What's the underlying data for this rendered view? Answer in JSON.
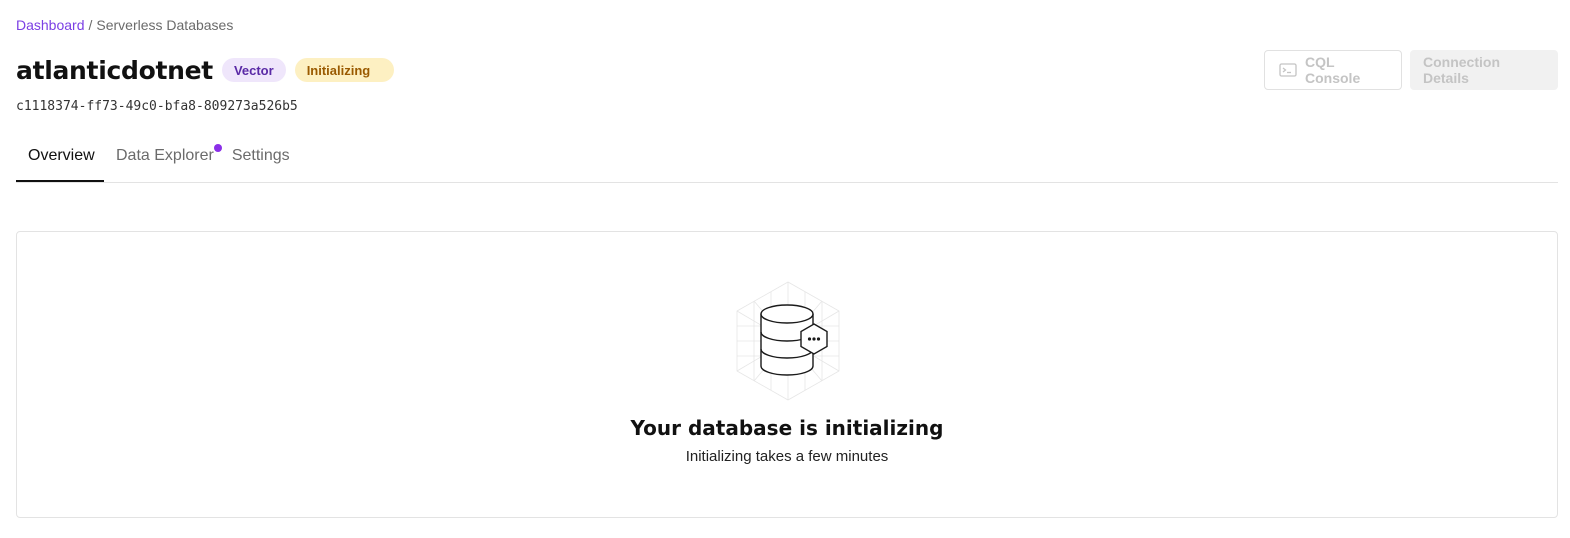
{
  "breadcrumb": {
    "root": "Dashboard",
    "separator": "/",
    "current": "Serverless Databases"
  },
  "database": {
    "name": "atlanticdotnet",
    "type_badge": "Vector",
    "status_badge": "Initializing",
    "id": "c1118374-ff73-49c0-bfa8-809273a526b5"
  },
  "actions": {
    "cql_console": "CQL Console",
    "connection_details": "Connection Details"
  },
  "tabs": [
    {
      "label": "Overview",
      "active": true
    },
    {
      "label": "Data Explorer",
      "active": false,
      "notification": true
    },
    {
      "label": "Settings",
      "active": false
    }
  ],
  "empty_state": {
    "icon": "database-initializing-icon",
    "title": "Your database is initializing",
    "subtitle": "Initializing takes a few minutes"
  },
  "colors": {
    "accent": "#7b3fe4",
    "vector_badge_bg": "#efe6fb",
    "vector_badge_text": "#5a2aa6",
    "status_badge_bg": "#fdf0c2",
    "status_badge_text": "#9a5a00",
    "notification_dot": "#8b2fe8"
  }
}
